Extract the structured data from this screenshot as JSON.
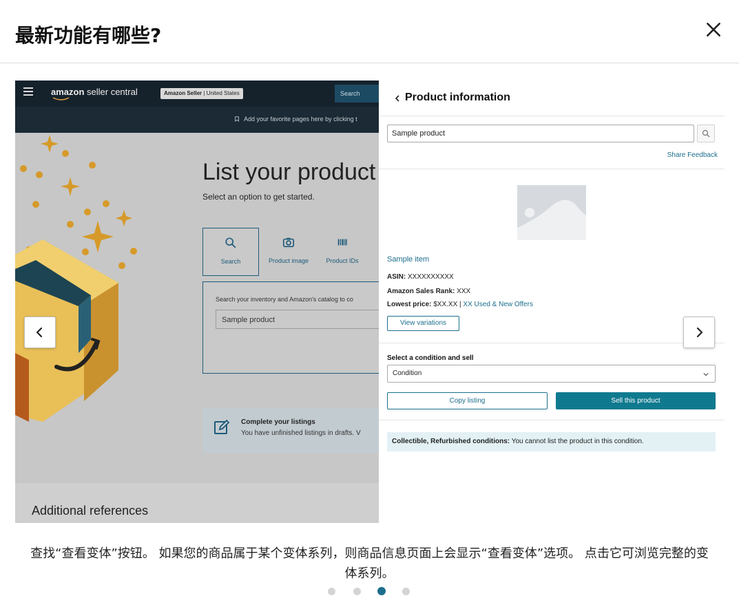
{
  "modal": {
    "title": "最新功能有哪些?",
    "caption": "查找“查看变体”按钮。 如果您的商品属于某个变体系列，则商品信息页面上会显示“查看变体”选项。 点击它可浏览完整的变体系列。",
    "active_slide": 3,
    "slide_count": 4
  },
  "seller_central": {
    "brand_light": "amazon",
    "brand_rest": " seller central",
    "account_name": "Amazon Seller",
    "account_region": "United States",
    "search_label": "Search",
    "favorites_text": "Add your favorite pages here by clicking t",
    "list_title": "List your product",
    "list_subtitle": "Select an option to get started.",
    "tabs": [
      {
        "label": "Search",
        "icon": "search-icon"
      },
      {
        "label": "Product image",
        "icon": "camera-icon"
      },
      {
        "label": "Product IDs",
        "icon": "barcode-icon"
      }
    ],
    "search_hint": "Search your inventory and Amazon's catalog to co",
    "search_value": "Sample product",
    "complete_title": "Complete your listings",
    "complete_text": "You have unfinished listings in drafts. V",
    "additional_refs": "Additional references"
  },
  "product_panel": {
    "title": "Product information",
    "search_value": "Sample product",
    "share_feedback": "Share Feedback",
    "item_name": "Sample item",
    "asin_label": "ASIN:",
    "asin_value": " XXXXXXXXXX",
    "rank_label": "Amazon Sales Rank:",
    "rank_value": " XXX",
    "lowest_label": "Lowest price:",
    "lowest_value": " $XX.XX | ",
    "offers_link": "XX Used & New Offers",
    "view_variations": "View variations",
    "condition_label": "Select a condition and sell",
    "condition_value": "Condition",
    "copy_listing": "Copy listing",
    "sell_product": "Sell this product",
    "notice_bold": "Collectible, Refurbished conditions:",
    "notice_text": " You cannot list the product in this condition."
  },
  "colors": {
    "accent": "#1c6e8c",
    "sell_button": "#0f7a8f",
    "topbar": "#15222c"
  }
}
